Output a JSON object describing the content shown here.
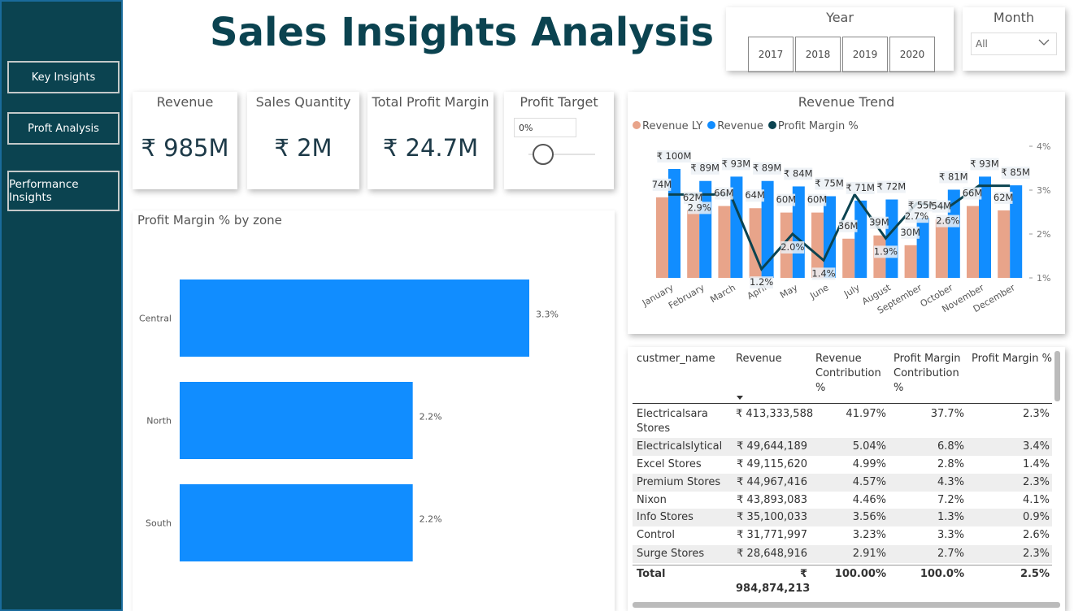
{
  "title": "Sales Insights Analysis",
  "nav": {
    "key_insights": "Key Insights",
    "profit_analysis": "Proft Analysis",
    "performance_insights": "Performance Insights"
  },
  "year_slicer": {
    "title": "Year",
    "options": [
      "2017",
      "2018",
      "2019",
      "2020"
    ]
  },
  "month_slicer": {
    "title": "Month",
    "selected": "All"
  },
  "kpis": {
    "revenue": {
      "label": "Revenue",
      "value": "₹ 985M"
    },
    "sales_quantity": {
      "label": "Sales Quantity",
      "value": "₹ 2M"
    },
    "total_profit_margin": {
      "label": "Total Profit Margin",
      "value": "₹ 24.7M"
    },
    "profit_target": {
      "label": "Profit Target",
      "input_value": "0%",
      "slider_fraction": 0
    }
  },
  "zone_chart": {
    "title": "Profit Margin % by zone",
    "chart_data": {
      "type": "bar",
      "orientation": "horizontal",
      "categories": [
        "Central",
        "North",
        "South"
      ],
      "values": [
        3.3,
        2.2,
        2.2
      ],
      "labels": [
        "3.3%",
        "2.2%",
        "2.2%"
      ],
      "color": "#118dff"
    }
  },
  "trend_chart": {
    "title": "Revenue Trend",
    "legend": [
      {
        "name": "Revenue LY",
        "color": "#e8a48a"
      },
      {
        "name": "Revenue",
        "color": "#118dff"
      },
      {
        "name": "Profit Margin %",
        "color": "#0b4350"
      }
    ],
    "right_axis_ticks": [
      "4%",
      "3%",
      "2%",
      "1%"
    ],
    "chart_data": {
      "type": "bar",
      "categories": [
        "January",
        "February",
        "March",
        "April",
        "May",
        "June",
        "July",
        "August",
        "September",
        "October",
        "November",
        "December"
      ],
      "series": [
        {
          "name": "Revenue LY",
          "values": [
            74,
            62,
            66,
            64,
            60,
            60,
            36,
            39,
            30,
            54,
            66,
            62
          ],
          "labels": [
            "74M",
            "62M",
            "66M",
            "64M",
            "60M",
            "60M",
            "36M",
            "39M",
            "30M",
            "54M",
            "66M",
            "62M"
          ]
        },
        {
          "name": "Revenue",
          "values": [
            100,
            89,
            93,
            89,
            84,
            75,
            71,
            72,
            55,
            81,
            93,
            85
          ],
          "labels": [
            "₹ 100M",
            "₹ 89M",
            "₹ 93M",
            "₹ 89M",
            "₹ 84M",
            "₹ 75M",
            "₹ 71M",
            "₹ 72M",
            "₹ 55M",
            "₹ 81M",
            "₹ 93M",
            "₹ 85M"
          ]
        },
        {
          "name": "Profit Margin %",
          "values": [
            2.9,
            2.9,
            2.9,
            1.2,
            2.0,
            1.4,
            2.9,
            1.9,
            2.7,
            2.6,
            3.1,
            3.1
          ],
          "labels": [
            "",
            "2.9%",
            "",
            "1.2%",
            "2.0%",
            "1.4%",
            "",
            "1.9%",
            "2.7%",
            "2.6%",
            "",
            ""
          ]
        }
      ],
      "y2lim": [
        1,
        4
      ]
    }
  },
  "customer_table": {
    "headers": [
      "custmer_name",
      "Revenue",
      "Revenue Contribution %",
      "Profit Margin Contribution %",
      "Profit Margin %"
    ],
    "rows": [
      [
        "Electricalsara Stores",
        "₹ 413,333,588",
        "41.97%",
        "37.7%",
        "2.3%"
      ],
      [
        "Electricalslytical",
        "₹ 49,644,189",
        "5.04%",
        "6.8%",
        "3.4%"
      ],
      [
        "Excel Stores",
        "₹ 49,115,620",
        "4.99%",
        "2.8%",
        "1.4%"
      ],
      [
        "Premium Stores",
        "₹ 44,967,416",
        "4.57%",
        "4.3%",
        "2.3%"
      ],
      [
        "Nixon",
        "₹ 43,893,083",
        "4.46%",
        "7.2%",
        "4.1%"
      ],
      [
        "Info Stores",
        "₹ 35,100,033",
        "3.56%",
        "1.3%",
        "0.9%"
      ],
      [
        "Control",
        "₹ 31,771,997",
        "3.23%",
        "3.3%",
        "2.6%"
      ],
      [
        "Surge Stores",
        "₹ 28,648,916",
        "2.91%",
        "2.7%",
        "2.3%"
      ]
    ],
    "total": [
      "Total",
      "₹ 984,874,213",
      "100.00%",
      "100.0%",
      "2.5%"
    ]
  }
}
